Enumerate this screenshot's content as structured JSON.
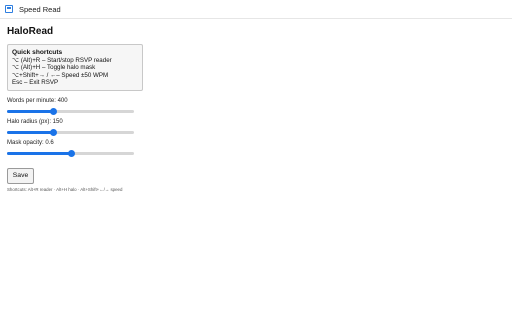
{
  "window": {
    "title": "Speed Read",
    "icon": "app-window-icon"
  },
  "page": {
    "heading": "HaloRead"
  },
  "shortcuts": {
    "title": "Quick shortcuts",
    "lines": [
      "⌥ (Alt)+R – Start/stop RSVP reader",
      "⌥ (Alt)+H – Toggle halo mask",
      "⌥+Shift+→ / ←– Speed ±50 WPM",
      "Esc – Exit RSVP"
    ]
  },
  "settings": {
    "wpm": {
      "label": "Words per minute: 400",
      "fraction": 0.36
    },
    "halo_radius": {
      "label": "Halo radius (px): 150",
      "fraction": 0.36
    },
    "mask_opacity": {
      "label": "Mask opacity: 0.6",
      "fraction": 0.5
    }
  },
  "buttons": {
    "save": "Save"
  },
  "footer": {
    "note": "Shortcuts: Alt+R reader · Alt+H halo · Alt+Shift+←/→ speed"
  },
  "colors": {
    "accent": "#1a73e8",
    "track": "#d6d6d6"
  }
}
